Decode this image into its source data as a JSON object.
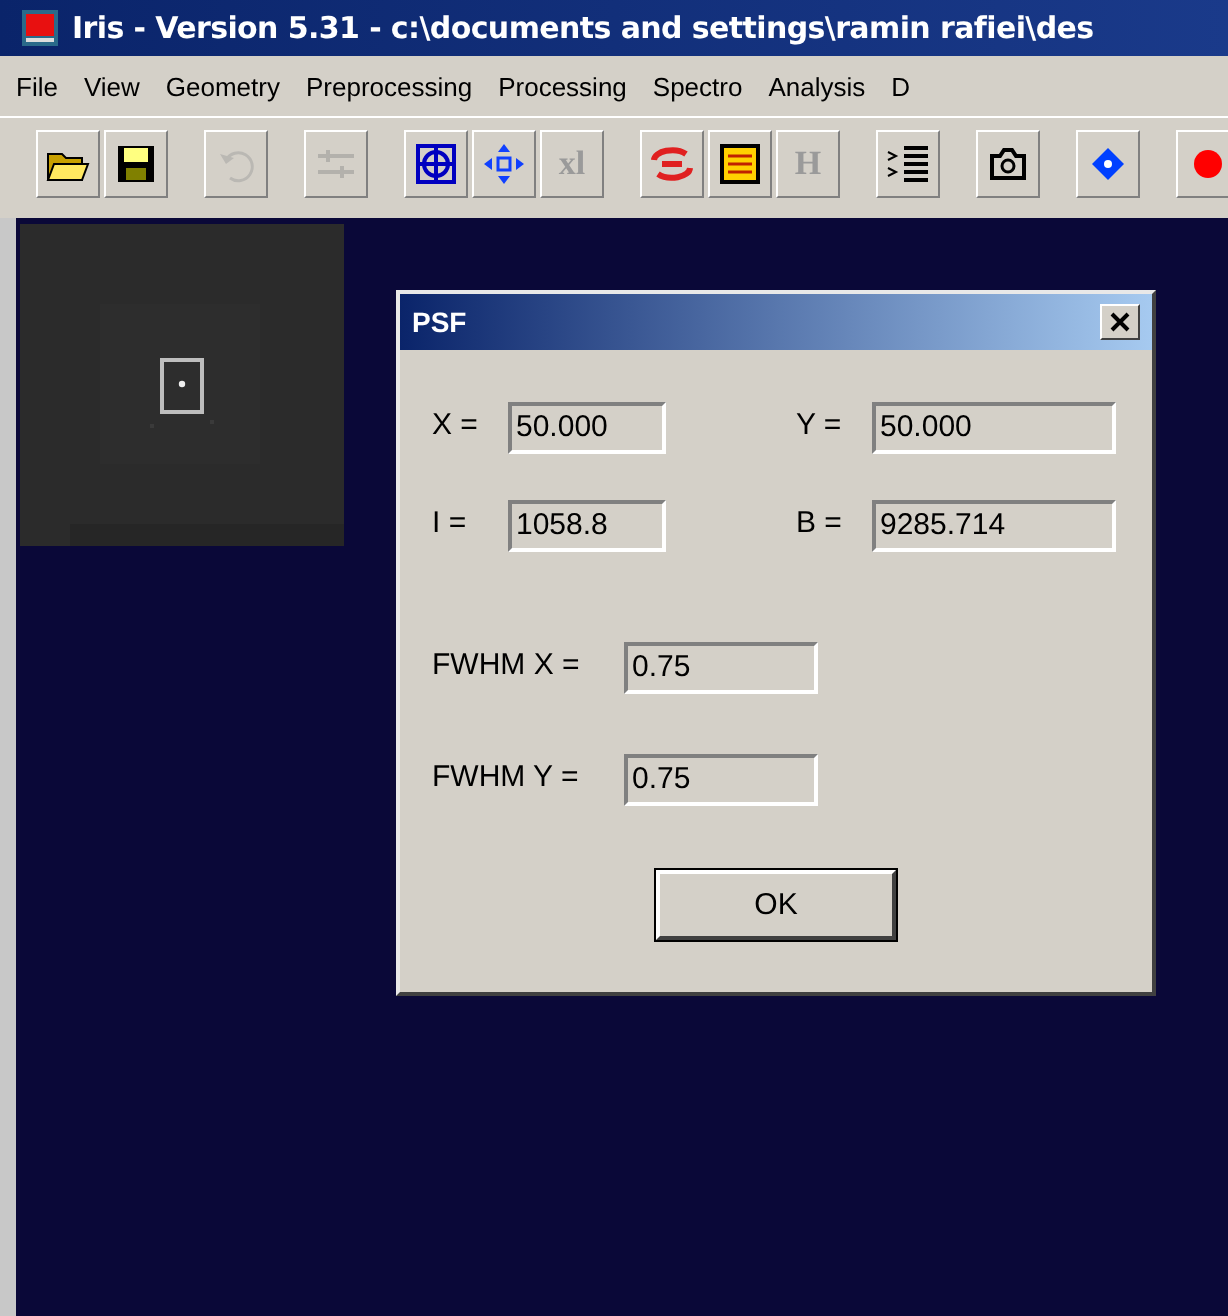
{
  "window": {
    "title": "Iris - Version 5.31 - c:\\documents and settings\\ramin rafiei\\des"
  },
  "menu": [
    "File",
    "View",
    "Geometry",
    "Preprocessing",
    "Processing",
    "Spectro",
    "Analysis",
    "D"
  ],
  "toolbar": [
    {
      "disabled": false
    },
    {
      "disabled": false
    },
    {
      "disabled": true
    },
    {
      "disabled": true
    },
    {
      "disabled": false
    },
    {
      "disabled": false
    },
    {
      "disabled": true,
      "label": "xl"
    },
    {
      "disabled": false
    },
    {
      "disabled": false
    },
    {
      "disabled": true,
      "label": "H"
    },
    {
      "disabled": false
    },
    {
      "disabled": false
    },
    {
      "disabled": false
    },
    {
      "disabled": false
    }
  ],
  "dialog": {
    "title": "PSF",
    "pairs": [
      [
        {
          "label": "X =",
          "value": "50.000"
        },
        {
          "label": "Y =",
          "value": "50.000"
        }
      ],
      [
        {
          "label": "I =",
          "value": "1058.8"
        },
        {
          "label": "B =",
          "value": "9285.714"
        }
      ]
    ],
    "fwhm": [
      {
        "label": "FWHM X =",
        "value": "0.75"
      },
      {
        "label": "FWHM Y =",
        "value": "0.75"
      }
    ],
    "button": "OK"
  }
}
